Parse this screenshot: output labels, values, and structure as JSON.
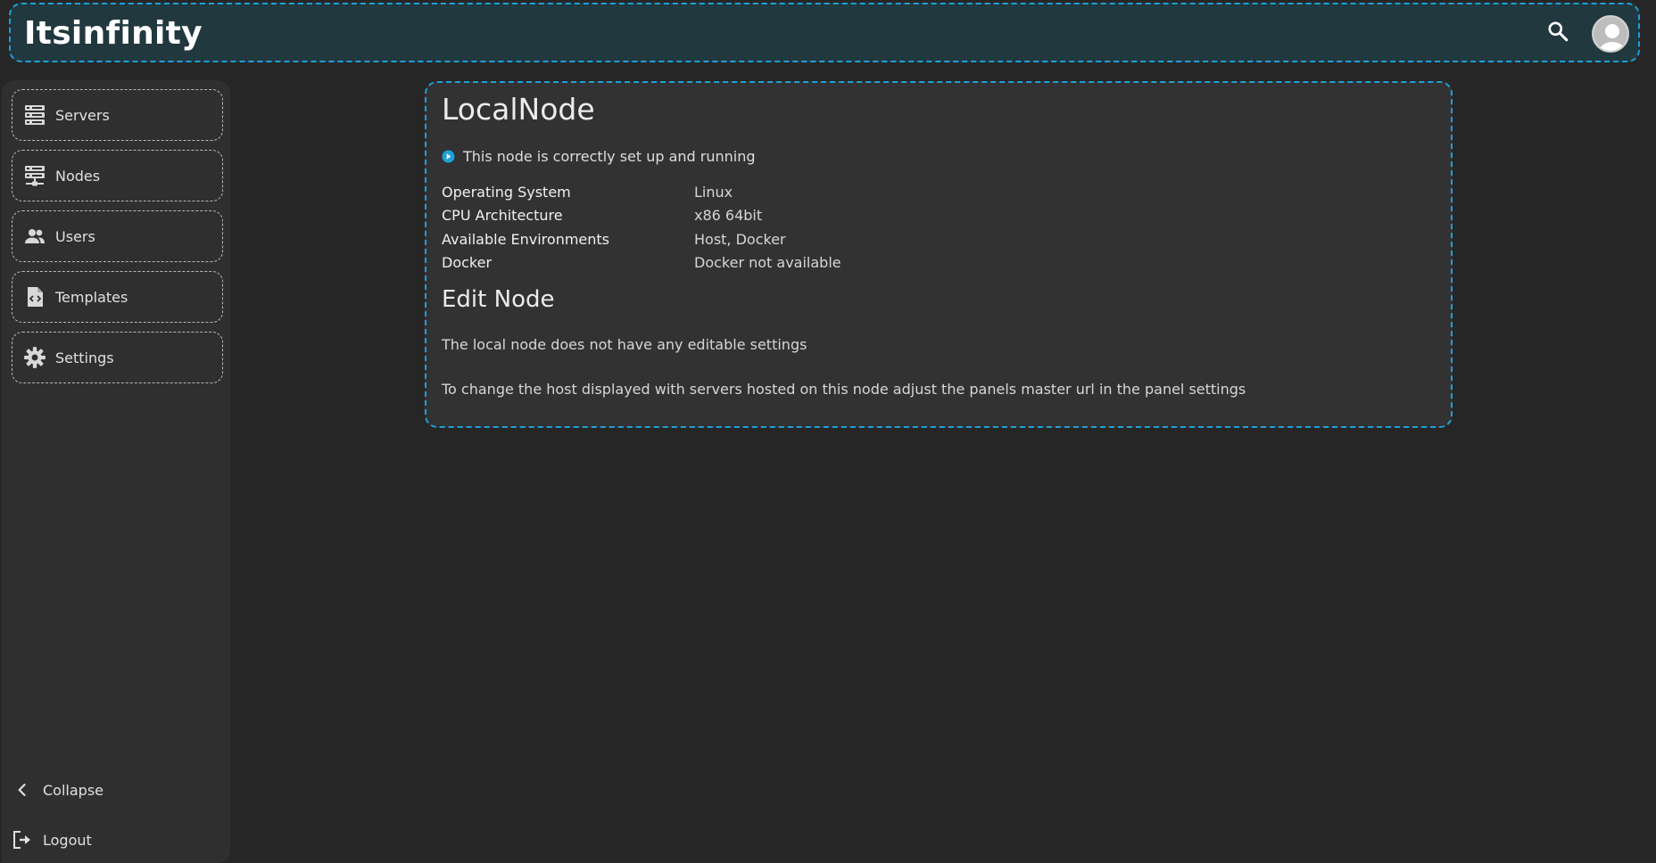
{
  "header": {
    "brand": "Itsinfinity",
    "search_icon": "search-icon",
    "avatar_icon": "user-avatar-icon"
  },
  "sidebar": {
    "items": [
      {
        "label": "Servers",
        "icon": "servers-icon"
      },
      {
        "label": "Nodes",
        "icon": "nodes-icon"
      },
      {
        "label": "Users",
        "icon": "users-icon"
      },
      {
        "label": "Templates",
        "icon": "templates-icon"
      },
      {
        "label": "Settings",
        "icon": "gear-icon"
      }
    ],
    "collapse_label": "Collapse",
    "logout_label": "Logout"
  },
  "node": {
    "title": "LocalNode",
    "status_text": "This node is correctly set up and running",
    "info": [
      {
        "key": "Operating System",
        "value": "Linux"
      },
      {
        "key": "CPU Architecture",
        "value": "x86 64bit"
      },
      {
        "key": "Available Environments",
        "value": "Host, Docker"
      },
      {
        "key": "Docker",
        "value": "Docker not available"
      }
    ],
    "edit_title": "Edit Node",
    "edit_text_1": "The local node does not have any editable settings",
    "edit_text_2": "To change the host displayed with servers hosted on this node adjust the panels master url in the panel settings"
  },
  "colors": {
    "accent": "#1ea0d8",
    "header_bg": "#22383f",
    "page_bg": "#262626",
    "sidebar_bg": "#2f2f2f",
    "panel_bg": "#323232"
  }
}
